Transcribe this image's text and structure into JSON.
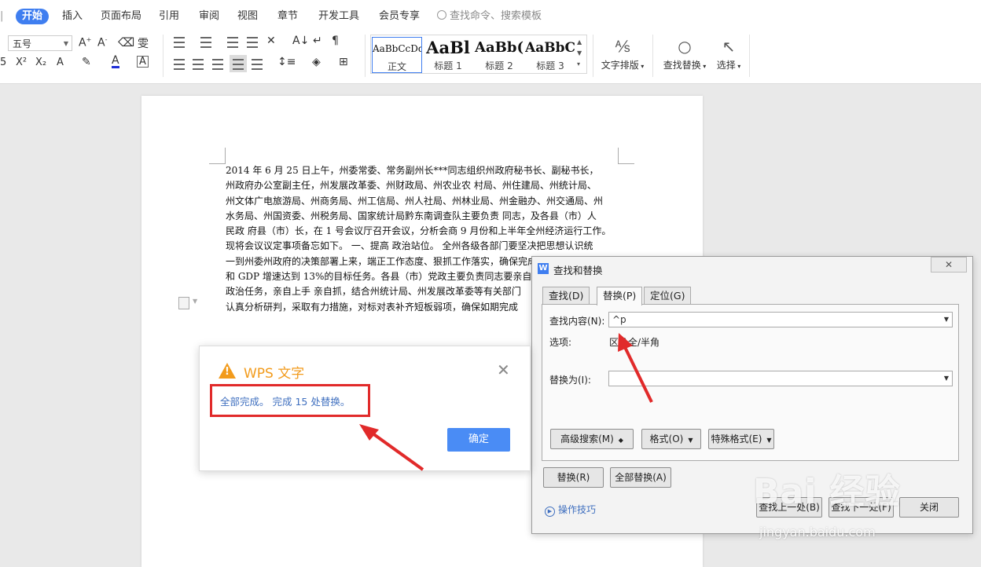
{
  "menu": {
    "tabs": [
      {
        "label": "开始",
        "active": true
      },
      {
        "label": "插入"
      },
      {
        "label": "页面布局"
      },
      {
        "label": "引用"
      },
      {
        "label": "审阅"
      },
      {
        "label": "视图"
      },
      {
        "label": "章节"
      },
      {
        "label": "开发工具"
      },
      {
        "label": "会员专享"
      }
    ],
    "search_placeholder": "查找命令、搜索模板"
  },
  "ribbon": {
    "font_size": "五号",
    "styles": [
      {
        "sample": "AaBbCcDd",
        "label": "正文"
      },
      {
        "sample": "AaBl",
        "label": "标题 1"
      },
      {
        "sample": "AaBb(",
        "label": "标题 2"
      },
      {
        "sample": "AaBbC",
        "label": "标题 3"
      }
    ],
    "text_layout": "文字排版",
    "find_replace": "查找替换",
    "select": "选择"
  },
  "document": {
    "lines": [
      "2014 年 6 月 25 日上午，州委常委、常务副州长***同志组织州政府秘书长、副秘书长，",
      "州政府办公室副主任，州发展改革委、州财政局、州农业农 村局、州住建局、州统计局、",
      "州文体广电旅游局、州商务局、州工信局、州人社局、州林业局、州金融办、州交通局、州",
      "水务局、州国资委、州税务局、国家统计局黔东南调查队主要负责 同志，及各县（市）人",
      "民政 府县（市）长，在 1 号会议厅召开会议，分析会商 9 月份和上半年全州经济运行工作。",
      "现将会议议定事项备忘如下。 一、提高 政治站位。 全州各级各部门要坚决把思想认识统",
      "一到州委州政府的决策部署上来，端正工作态度、狠抓工作落实，确保完成全州一季度",
      "和 GDP 增速达到 13%的目标任务。各县（市）党政主要负责同志要亲自",
      "政治任务，亲自上手 亲自抓，结合州统计局、州发展改革委等有关部门",
      "认真分析研判，采取有力措施，对标对表补齐短板弱项，确保如期完成"
    ]
  },
  "alert": {
    "title": "WPS 文字",
    "message": "全部完成。 完成 15 处替换。",
    "ok": "确定"
  },
  "find_replace": {
    "title": "查找和替换",
    "tabs": [
      "查找(D)",
      "替换(P)",
      "定位(G)"
    ],
    "find_label": "查找内容(N):",
    "find_value": "^p",
    "options_label": "选项:",
    "options_value": "区分全/半角",
    "replace_label": "替换为(I):",
    "replace_value": "",
    "buttons": {
      "advanced": "高级搜索(M)",
      "format": "格式(O)",
      "special": "特殊格式(E)",
      "replace": "替换(R)",
      "replace_all": "全部替换(A)",
      "find_prev": "查找上一处(B)",
      "find_next": "查找下一处(F)",
      "close": "关闭"
    },
    "tips": "操作技巧"
  },
  "watermark": {
    "brand": "Bai 经验",
    "url": "jingyan.baidu.com"
  },
  "colors": {
    "accent": "#3f7ef0",
    "warning": "#f29b1c",
    "highlight_red": "#e12a2a"
  }
}
